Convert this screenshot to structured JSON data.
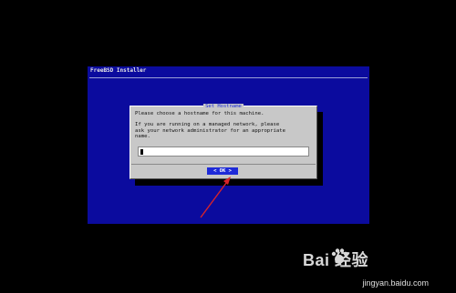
{
  "window": {
    "title": "FreeBSD Installer"
  },
  "dialog": {
    "title": "Set Hostname",
    "message": "Please choose a hostname for this machine.\n\nIf you are running on a managed network, please\nask your network administrator for an appropriate\nname.",
    "hostname_value": "",
    "ok_label": "<  OK  >"
  },
  "watermark": {
    "brand": "Bai  经验",
    "url": "jingyan.baidu.com"
  },
  "colors": {
    "background": "#000000",
    "screen": "#0b0b9e",
    "dialog": "#c8c8c8",
    "button": "#1e2ad8",
    "arrow": "#d8232a"
  }
}
